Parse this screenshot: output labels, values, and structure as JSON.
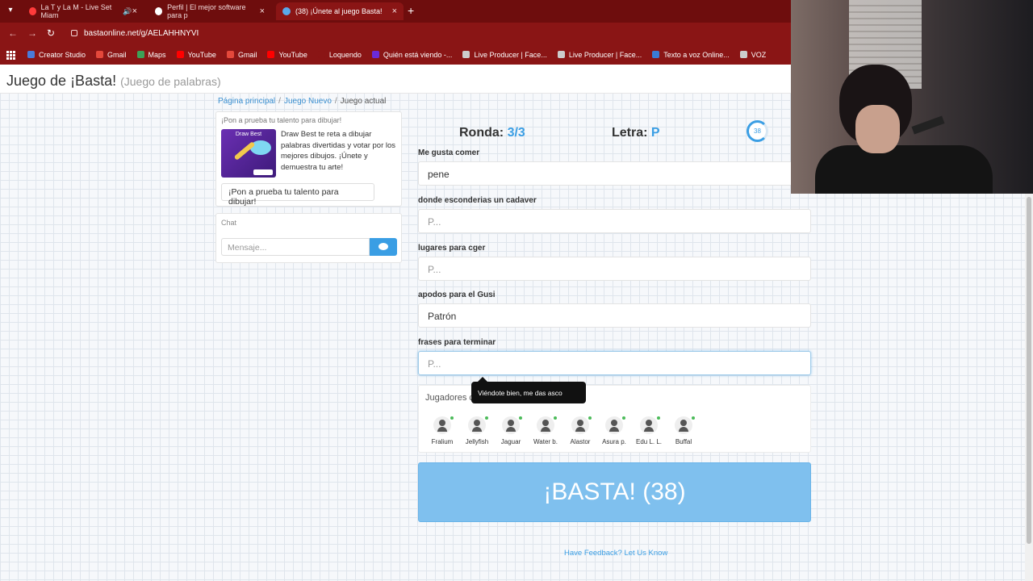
{
  "browser": {
    "tabs": [
      {
        "title": "La T y La M - Live Set Miam",
        "icon_color": "#ff3b3b",
        "active": false
      },
      {
        "title": "Perfil | El mejor software para p",
        "icon_color": "#ffffff",
        "active": false
      },
      {
        "title": "(38) ¡Únete al juego Basta!",
        "icon_color": "#5aa8ea",
        "active": true
      }
    ],
    "url": "bastaonline.net/g/AELAHHNYVI",
    "bookmarks": [
      {
        "label": "Creator Studio",
        "icon_color": "#4a7bd9"
      },
      {
        "label": "Gmail",
        "icon_color": "#e4483b"
      },
      {
        "label": "Maps",
        "icon_color": "#3da157"
      },
      {
        "label": "YouTube",
        "icon_color": "#ff0000"
      },
      {
        "label": "Gmail",
        "icon_color": "#e4483b"
      },
      {
        "label": "YouTube",
        "icon_color": "#ff0000"
      },
      {
        "label": "Loquendo",
        "icon_color": "#8a1515"
      },
      {
        "label": "Quién está viendo -...",
        "icon_color": "#6a2bd8"
      },
      {
        "label": "Live Producer | Face...",
        "icon_color": "#cccccc"
      },
      {
        "label": "Live Producer | Face...",
        "icon_color": "#cccccc"
      },
      {
        "label": "Texto a voz Online...",
        "icon_color": "#3a7bd5"
      },
      {
        "label": "VOZ",
        "icon_color": "#cccccc"
      }
    ]
  },
  "site": {
    "title": "Juego de ¡Basta!",
    "subtitle": "(Juego de palabras)"
  },
  "breadcrumb": {
    "home": "Página principal",
    "new_game": "Juego Nuevo",
    "current": "Juego actual"
  },
  "promo": {
    "heading": "¡Pon a prueba tu talento para dibujar!",
    "image_title": "Draw Best",
    "text": "Draw Best te reta a dibujar palabras divertidas y votar por los mejores dibujos. ¡Únete y demuestra tu arte!",
    "button": "¡Pon a prueba tu talento para dibujar!"
  },
  "chat": {
    "label": "Chat",
    "placeholder": "Mensaje..."
  },
  "game": {
    "round_label": "Ronda:",
    "round_value": "3/3",
    "letter_label": "Letra:",
    "letter_value": "P",
    "timer": "38",
    "timer_fraction": 0.75
  },
  "fields": [
    {
      "label": "Me gusta comer",
      "value": "pene",
      "placeholder": ""
    },
    {
      "label": "donde esconderias un cadaver",
      "value": "",
      "placeholder": "P..."
    },
    {
      "label": "lugares para cger",
      "value": "",
      "placeholder": "P..."
    },
    {
      "label": "apodos para el Gusi",
      "value": "Patrón",
      "placeholder": ""
    },
    {
      "label": "frases para terminar",
      "value": "",
      "placeholder": "P..."
    }
  ],
  "players": {
    "label": "Jugadores c",
    "list": [
      "Fralium",
      "Jellyfish",
      "Jaguar",
      "Water b.",
      "Alastor",
      "Asura p.",
      "Edu L. L.",
      "Buffal"
    ]
  },
  "tooltip": "Viéndote bien, me das asco",
  "basta_button": "¡BASTA! (38)",
  "feedback": "Have Feedback? Let Us Know"
}
